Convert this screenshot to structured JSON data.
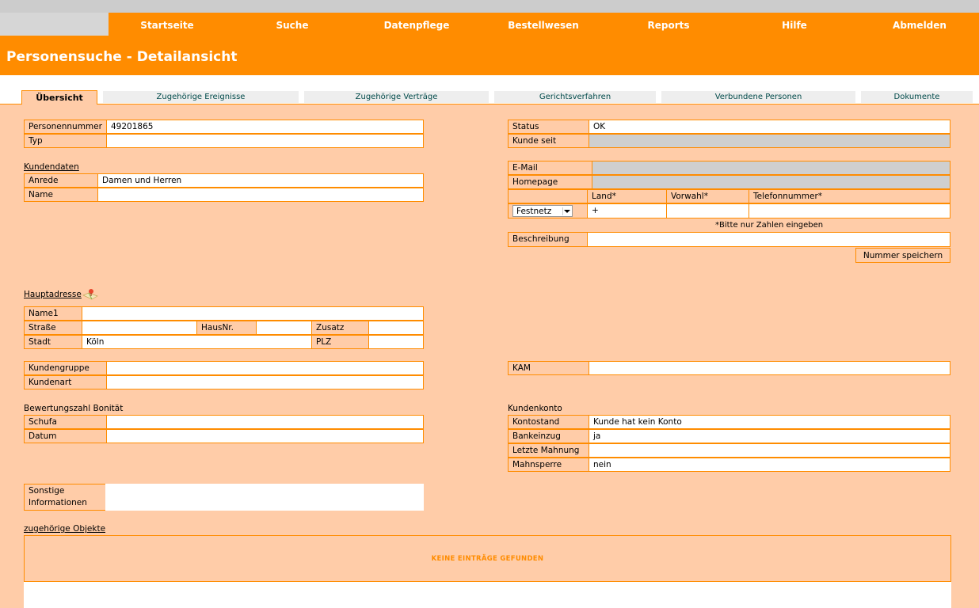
{
  "nav": {
    "items": [
      "Startseite",
      "Suche",
      "Datenpflege",
      "Bestellwesen",
      "Reports",
      "Hilfe",
      "Abmelden"
    ]
  },
  "page_title": "Personensuche - Detailansicht",
  "tabs": [
    "Übersicht",
    "Zugehörige Ereignisse",
    "Zugehörige Verträge",
    "Gerichtsverfahren",
    "Verbundene Personen",
    "Dokumente"
  ],
  "person": {
    "nummer_label": "Personennummer",
    "nummer_value": "49201865",
    "typ_label": "Typ",
    "typ_value": ""
  },
  "kundendaten": {
    "title": "Kundendaten",
    "anrede_label": "Anrede",
    "anrede_value": "Damen und Herren",
    "name_label": "Name",
    "name_value": ""
  },
  "status": {
    "status_label": "Status",
    "status_value": "OK",
    "kunde_seit_label": "Kunde seit",
    "kunde_seit_value": ""
  },
  "contact": {
    "email_label": "E-Mail",
    "email_value": "",
    "homepage_label": "Homepage",
    "homepage_value": "",
    "land_label": "Land*",
    "vorwahl_label": "Vorwahl*",
    "telefon_label": "Telefonnummer*",
    "phone_type": "Festnetz",
    "land_value": "+",
    "vorwahl_value": "",
    "telefon_value": "",
    "hint": "*Bitte nur Zahlen eingeben",
    "beschreibung_label": "Beschreibung",
    "beschreibung_value": "",
    "save_button": "Nummer speichern"
  },
  "adresse": {
    "title": "Hauptadresse",
    "name1_label": "Name1",
    "name1_value": "",
    "strasse_label": "Straße",
    "strasse_value": "",
    "hausnr_label": "HausNr.",
    "hausnr_value": "",
    "zusatz_label": "Zusatz",
    "zusatz_value": "",
    "stadt_label": "Stadt",
    "stadt_value": "Köln",
    "plz_label": "PLZ",
    "plz_value": ""
  },
  "kunde": {
    "gruppe_label": "Kundengruppe",
    "gruppe_value": "",
    "art_label": "Kundenart",
    "art_value": "",
    "kam_label": "KAM",
    "kam_value": ""
  },
  "bonitaet": {
    "title": "Bewertungszahl Bonität",
    "schufa_label": "Schufa",
    "schufa_value": "",
    "datum_label": "Datum",
    "datum_value": ""
  },
  "konto": {
    "title": "Kundenkonto",
    "kontostand_label": "Kontostand",
    "kontostand_value": "Kunde hat kein Konto",
    "bankeinzug_label": "Bankeinzug",
    "bankeinzug_value": "ja",
    "mahnung_label": "Letzte Mahnung",
    "mahnung_value": "",
    "sperre_label": "Mahnsperre",
    "sperre_value": "nein"
  },
  "sonstige": {
    "label_line1": "Sonstige",
    "label_line2": "Informationen",
    "value": ""
  },
  "objekte": {
    "title": "zugehörige Objekte",
    "empty": "KEINE EINTRÄGE GEFUNDEN"
  },
  "colors": {
    "accent": "#ff8c00",
    "panel": "#ffcca8",
    "readonly": "#cfcfcf"
  }
}
